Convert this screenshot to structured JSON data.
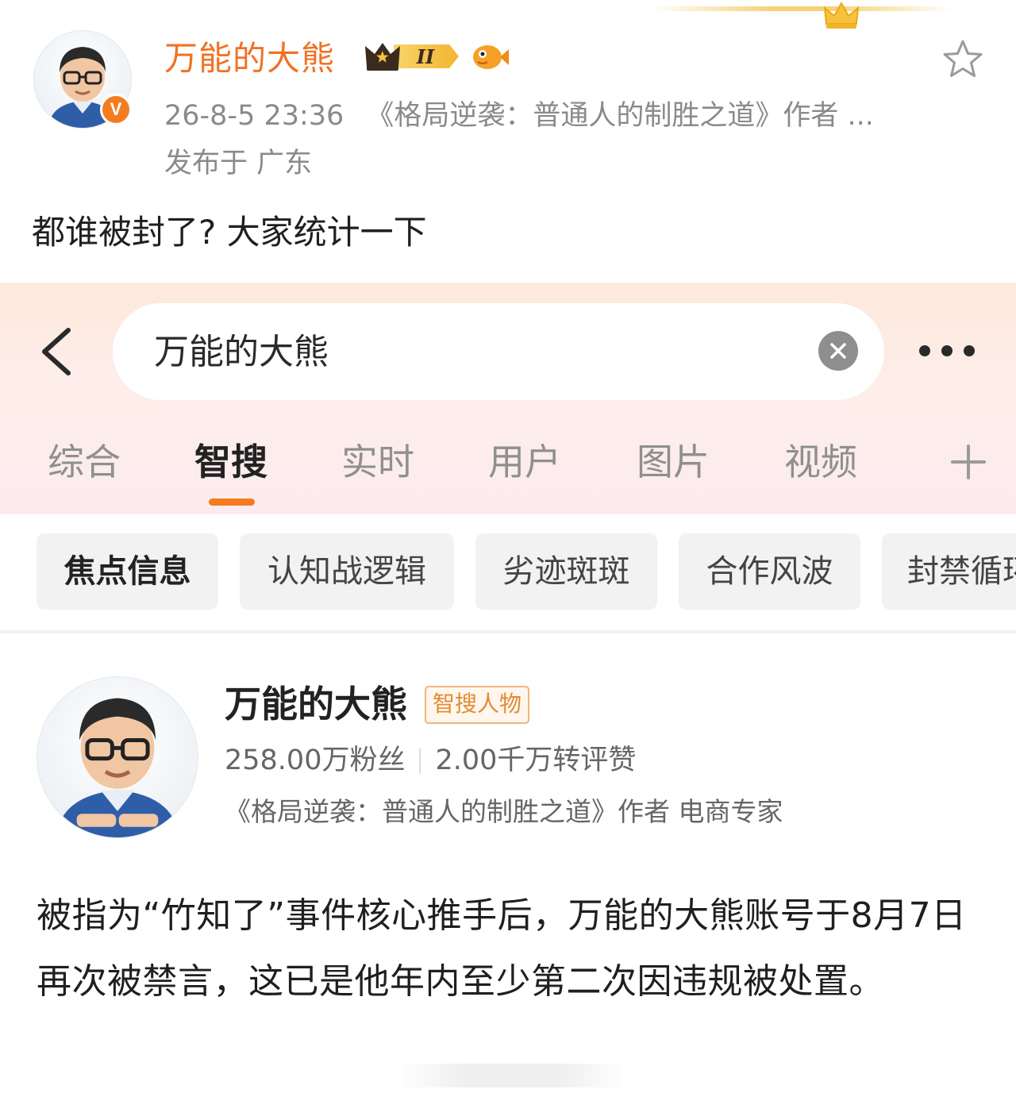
{
  "post": {
    "author_name": "万能的大熊",
    "vip_level": "II",
    "timestamp": "26-8-5 23:36",
    "author_desc": "《格局逆袭：普通人的制胜之道》作者 ...",
    "location": "发布于 广东",
    "text": "都谁被封了? 大家统计一下",
    "verified_badge": "V"
  },
  "search": {
    "query": "万能的大熊"
  },
  "tabs": [
    {
      "label": "综合"
    },
    {
      "label": "智搜",
      "active": true
    },
    {
      "label": "实时"
    },
    {
      "label": "用户"
    },
    {
      "label": "图片"
    },
    {
      "label": "视频"
    }
  ],
  "chips": [
    {
      "label": "焦点信息",
      "active": true
    },
    {
      "label": "认知战逻辑"
    },
    {
      "label": "劣迹斑斑"
    },
    {
      "label": "合作风波"
    },
    {
      "label": "封禁循环"
    }
  ],
  "profile": {
    "name": "万能的大熊",
    "tag": "智搜人物",
    "fans": "258.00万粉丝",
    "interactions": "2.00千万转评赞",
    "desc": "《格局逆袭：普通人的制胜之道》作者 电商专家"
  },
  "article": {
    "text": "被指为“竹知了”事件核心推手后，万能的大熊账号于8月7日再次被禁言，这已是他年内至少第二次因违规被处置。"
  },
  "colors": {
    "accent": "#f07226",
    "tab_underline": "#f47c20",
    "tag_border": "#efb57b",
    "muted_text": "#8a8a8a"
  },
  "icons": {
    "back": "chevron-left-icon",
    "clear": "clear-icon",
    "more": "more-dots-icon",
    "add_tab": "plus-icon",
    "favorite": "star-icon",
    "vip": "crown-vip-icon",
    "fan_badge": "fish-icon"
  }
}
